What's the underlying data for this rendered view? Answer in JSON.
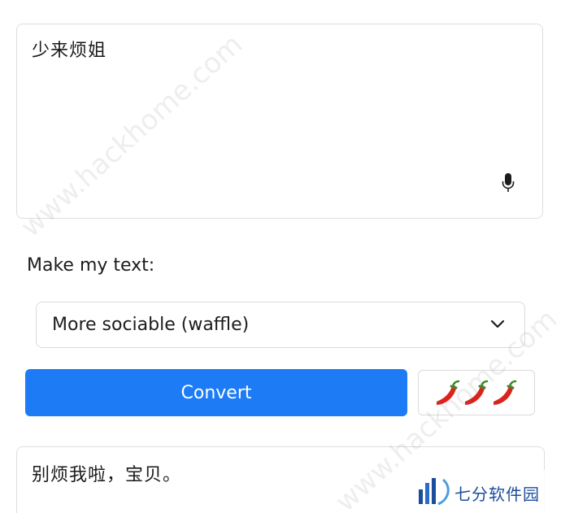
{
  "input": {
    "text": "少来烦姐",
    "mic_icon": "microphone-icon"
  },
  "options": {
    "label": "Make my text:",
    "selected": "More sociable (waffle)"
  },
  "actions": {
    "convert_label": "Convert",
    "spice_icon": "chili-pepper-icon",
    "spice_level": 3,
    "spice_max": 3
  },
  "output": {
    "text": "别烦我啦，宝贝。"
  },
  "watermark": {
    "text": "www.hackhome.com",
    "logo_text": "七分软件园"
  },
  "colors": {
    "accent": "#1d7bf5",
    "chili": "#d9241c",
    "logo": "#1a4d9c"
  }
}
